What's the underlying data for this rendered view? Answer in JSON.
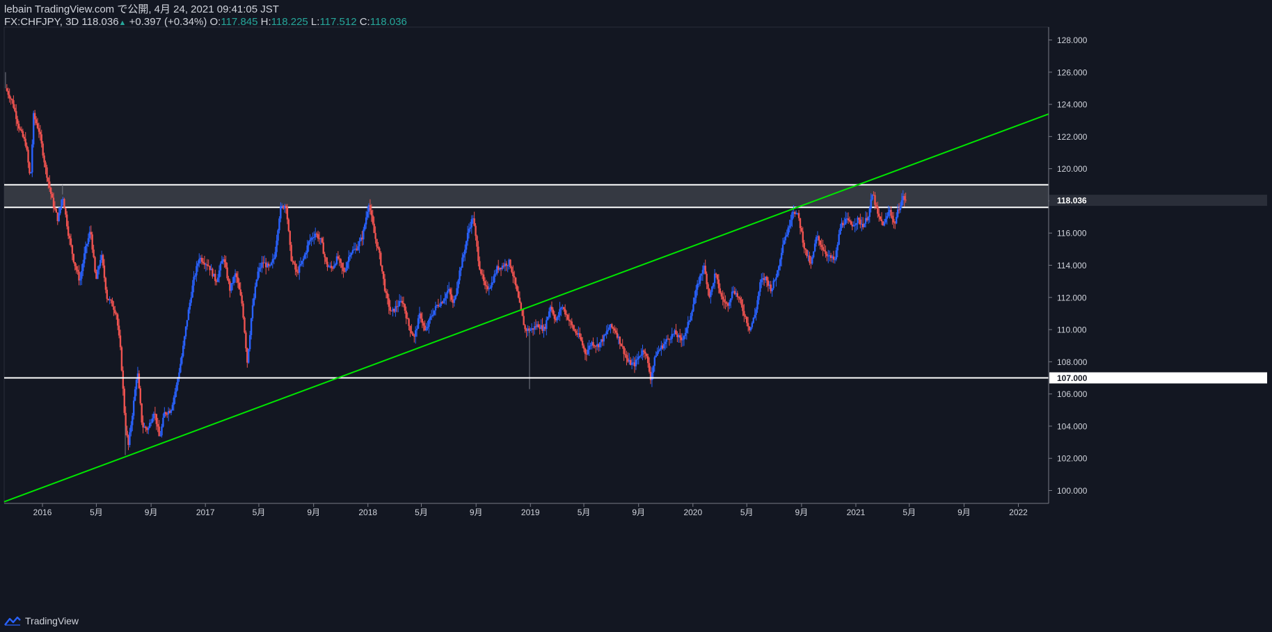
{
  "header": {
    "line1": "lebain TradingView.com で公開, 4月 24, 2021 09:41:05 JST",
    "symbol": "FX:CHFJPY, 3D",
    "last": "118.036",
    "change": "+0.397 (+0.34%)",
    "o_label": "O:",
    "o_value": "117.845",
    "h_label": "H:",
    "h_value": "118.225",
    "l_label": "L:",
    "l_value": "117.512",
    "c_label": "C:",
    "c_value": "118.036"
  },
  "footer": {
    "brand": "TradingView",
    "logo_icon": "tradingview-logo-icon"
  },
  "colors": {
    "background": "#131722",
    "up": "#2962ff",
    "down": "#ef5350",
    "trendline": "#00e600",
    "zone_fill": "#3a3d46",
    "level_line": "#ffffff",
    "axis_text": "#d1d4dc"
  },
  "chart_data": {
    "type": "candlestick",
    "title": "",
    "xlabel": "",
    "ylabel": "",
    "x_range": [
      "2015-10-07",
      "2022-03-10"
    ],
    "ylim": [
      99.2,
      128.8
    ],
    "y_ticks": [
      "100.000",
      "102.000",
      "104.000",
      "106.000",
      "108.000",
      "110.000",
      "112.000",
      "114.000",
      "116.000",
      "118.000",
      "120.000",
      "122.000",
      "124.000",
      "126.000",
      "128.000"
    ],
    "x_ticks": [
      {
        "label": "2016",
        "date": "2016-01-01"
      },
      {
        "label": "5月",
        "date": "2016-05-01"
      },
      {
        "label": "9月",
        "date": "2016-09-01"
      },
      {
        "label": "2017",
        "date": "2017-01-01"
      },
      {
        "label": "5月",
        "date": "2017-05-01"
      },
      {
        "label": "9月",
        "date": "2017-09-01"
      },
      {
        "label": "2018",
        "date": "2018-01-01"
      },
      {
        "label": "5月",
        "date": "2018-05-01"
      },
      {
        "label": "9月",
        "date": "2018-09-01"
      },
      {
        "label": "2019",
        "date": "2019-01-01"
      },
      {
        "label": "5月",
        "date": "2019-05-01"
      },
      {
        "label": "9月",
        "date": "2019-09-01"
      },
      {
        "label": "2020",
        "date": "2020-01-01"
      },
      {
        "label": "5月",
        "date": "2020-05-01"
      },
      {
        "label": "9月",
        "date": "2020-09-01"
      },
      {
        "label": "2021",
        "date": "2021-01-01"
      },
      {
        "label": "5月",
        "date": "2021-05-01"
      },
      {
        "label": "9月",
        "date": "2021-09-01"
      },
      {
        "label": "2022",
        "date": "2022-01-01"
      }
    ],
    "price_path": [
      [
        "2015-10-10",
        125.0
      ],
      [
        "2015-10-25",
        124.2
      ],
      [
        "2015-11-10",
        122.5
      ],
      [
        "2015-11-25",
        121.5
      ],
      [
        "2015-12-05",
        119.2
      ],
      [
        "2015-12-12",
        123.3
      ],
      [
        "2015-12-25",
        122.3
      ],
      [
        "2016-01-08",
        120.0
      ],
      [
        "2016-01-25",
        117.8
      ],
      [
        "2016-02-05",
        116.8
      ],
      [
        "2016-02-15",
        118.4
      ],
      [
        "2016-02-28",
        116.0
      ],
      [
        "2016-03-12",
        114.2
      ],
      [
        "2016-03-25",
        113.0
      ],
      [
        "2016-04-05",
        114.8
      ],
      [
        "2016-04-18",
        116.2
      ],
      [
        "2016-04-30",
        113.0
      ],
      [
        "2016-05-12",
        114.7
      ],
      [
        "2016-05-25",
        112.0
      ],
      [
        "2016-06-05",
        111.6
      ],
      [
        "2016-06-15",
        111.0
      ],
      [
        "2016-06-25",
        108.5
      ],
      [
        "2016-07-05",
        104.0
      ],
      [
        "2016-07-12",
        102.8
      ],
      [
        "2016-07-22",
        105.0
      ],
      [
        "2016-08-01",
        107.5
      ],
      [
        "2016-08-12",
        104.0
      ],
      [
        "2016-08-25",
        103.8
      ],
      [
        "2016-09-08",
        105.0
      ],
      [
        "2016-09-20",
        103.2
      ],
      [
        "2016-10-01",
        104.8
      ],
      [
        "2016-10-15",
        105.0
      ],
      [
        "2016-10-28",
        106.5
      ],
      [
        "2016-11-10",
        108.5
      ],
      [
        "2016-11-20",
        110.5
      ],
      [
        "2016-12-05",
        113.0
      ],
      [
        "2016-12-18",
        114.5
      ],
      [
        "2017-01-08",
        114.0
      ],
      [
        "2017-01-25",
        113.0
      ],
      [
        "2017-02-10",
        114.5
      ],
      [
        "2017-02-25",
        112.5
      ],
      [
        "2017-03-10",
        113.5
      ],
      [
        "2017-03-25",
        111.5
      ],
      [
        "2017-04-05",
        108.0
      ],
      [
        "2017-04-15",
        111.0
      ],
      [
        "2017-04-28",
        113.5
      ],
      [
        "2017-05-10",
        114.2
      ],
      [
        "2017-05-25",
        113.8
      ],
      [
        "2017-06-05",
        114.5
      ],
      [
        "2017-06-18",
        117.5
      ],
      [
        "2017-07-01",
        117.8
      ],
      [
        "2017-07-12",
        114.5
      ],
      [
        "2017-07-25",
        113.5
      ],
      [
        "2017-08-08",
        114.3
      ],
      [
        "2017-08-22",
        115.5
      ],
      [
        "2017-09-05",
        116.0
      ],
      [
        "2017-09-18",
        115.5
      ],
      [
        "2017-09-30",
        114.0
      ],
      [
        "2017-10-12",
        113.8
      ],
      [
        "2017-10-25",
        114.5
      ],
      [
        "2017-11-08",
        113.5
      ],
      [
        "2017-11-22",
        114.8
      ],
      [
        "2017-12-05",
        115.0
      ],
      [
        "2017-12-20",
        115.8
      ],
      [
        "2018-01-03",
        117.9
      ],
      [
        "2018-01-15",
        116.0
      ],
      [
        "2018-01-28",
        114.5
      ],
      [
        "2018-02-10",
        112.2
      ],
      [
        "2018-02-22",
        111.0
      ],
      [
        "2018-03-08",
        111.5
      ],
      [
        "2018-03-20",
        111.8
      ],
      [
        "2018-04-02",
        110.3
      ],
      [
        "2018-04-15",
        109.5
      ],
      [
        "2018-04-28",
        111.0
      ],
      [
        "2018-05-10",
        109.8
      ],
      [
        "2018-05-22",
        110.8
      ],
      [
        "2018-06-05",
        111.5
      ],
      [
        "2018-06-18",
        111.8
      ],
      [
        "2018-07-01",
        112.5
      ],
      [
        "2018-07-12",
        111.5
      ],
      [
        "2018-07-25",
        113.5
      ],
      [
        "2018-08-05",
        114.8
      ],
      [
        "2018-08-15",
        116.2
      ],
      [
        "2018-08-25",
        117.0
      ],
      [
        "2018-09-08",
        114.0
      ],
      [
        "2018-09-22",
        112.5
      ],
      [
        "2018-10-05",
        112.8
      ],
      [
        "2018-10-18",
        113.8
      ],
      [
        "2018-11-01",
        114.0
      ],
      [
        "2018-11-15",
        114.2
      ],
      [
        "2018-11-25",
        113.2
      ],
      [
        "2018-12-08",
        111.5
      ],
      [
        "2018-12-20",
        110.0
      ],
      [
        "2019-01-03",
        110.0
      ],
      [
        "2019-01-18",
        110.3
      ],
      [
        "2019-02-01",
        110.0
      ],
      [
        "2019-02-15",
        111.5
      ],
      [
        "2019-02-28",
        110.5
      ],
      [
        "2019-03-12",
        111.5
      ],
      [
        "2019-03-25",
        110.8
      ],
      [
        "2019-04-08",
        110.0
      ],
      [
        "2019-04-22",
        109.5
      ],
      [
        "2019-05-05",
        108.5
      ],
      [
        "2019-05-18",
        109.2
      ],
      [
        "2019-06-01",
        109.0
      ],
      [
        "2019-06-15",
        109.5
      ],
      [
        "2019-06-28",
        110.2
      ],
      [
        "2019-07-10",
        110.0
      ],
      [
        "2019-07-25",
        109.0
      ],
      [
        "2019-08-08",
        108.0
      ],
      [
        "2019-08-22",
        107.8
      ],
      [
        "2019-09-05",
        108.5
      ],
      [
        "2019-09-15",
        108.8
      ],
      [
        "2019-09-28",
        107.0
      ],
      [
        "2019-10-10",
        108.5
      ],
      [
        "2019-10-25",
        109.0
      ],
      [
        "2019-11-08",
        109.5
      ],
      [
        "2019-11-22",
        109.8
      ],
      [
        "2019-12-05",
        109.3
      ],
      [
        "2019-12-18",
        110.0
      ],
      [
        "2020-01-01",
        111.5
      ],
      [
        "2020-01-12",
        112.8
      ],
      [
        "2020-01-25",
        114.0
      ],
      [
        "2020-02-08",
        112.0
      ],
      [
        "2020-02-20",
        113.5
      ],
      [
        "2020-03-05",
        112.0
      ],
      [
        "2020-03-18",
        111.5
      ],
      [
        "2020-04-01",
        112.5
      ],
      [
        "2020-04-12",
        112.0
      ],
      [
        "2020-04-25",
        111.0
      ],
      [
        "2020-05-08",
        110.0
      ],
      [
        "2020-05-20",
        111.0
      ],
      [
        "2020-06-01",
        113.0
      ],
      [
        "2020-06-12",
        113.2
      ],
      [
        "2020-06-25",
        112.5
      ],
      [
        "2020-07-08",
        113.5
      ],
      [
        "2020-07-22",
        115.5
      ],
      [
        "2020-08-02",
        116.2
      ],
      [
        "2020-08-12",
        117.5
      ],
      [
        "2020-08-25",
        117.0
      ],
      [
        "2020-09-08",
        115.0
      ],
      [
        "2020-09-22",
        114.0
      ],
      [
        "2020-10-05",
        115.8
      ],
      [
        "2020-10-20",
        115.0
      ],
      [
        "2020-11-02",
        114.5
      ],
      [
        "2020-11-15",
        114.3
      ],
      [
        "2020-11-28",
        116.5
      ],
      [
        "2020-12-10",
        116.8
      ],
      [
        "2020-12-22",
        116.5
      ],
      [
        "2021-01-05",
        116.8
      ],
      [
        "2021-01-18",
        116.5
      ],
      [
        "2021-01-30",
        117.2
      ],
      [
        "2021-02-08",
        118.5
      ],
      [
        "2021-02-20",
        117.0
      ],
      [
        "2021-03-05",
        116.5
      ],
      [
        "2021-03-18",
        117.5
      ],
      [
        "2021-03-28",
        116.5
      ],
      [
        "2021-04-10",
        117.8
      ],
      [
        "2021-04-17",
        118.2
      ],
      [
        "2021-04-24",
        118.036
      ]
    ],
    "wick_spikes": [
      [
        "2016-07-05",
        102.2
      ],
      [
        "2018-12-30",
        106.3
      ],
      [
        "2016-02-15",
        119.0
      ],
      [
        "2015-10-10",
        126.0
      ]
    ],
    "annotations": {
      "resistance_zone": {
        "low": 117.6,
        "high": 119.0
      },
      "support_line": 107.0,
      "trendline": {
        "start": [
          "2015-10-07",
          99.3
        ],
        "end": [
          "2022-03-10",
          123.4
        ]
      },
      "last_price_label": "118.036",
      "support_label": "107.000"
    }
  }
}
